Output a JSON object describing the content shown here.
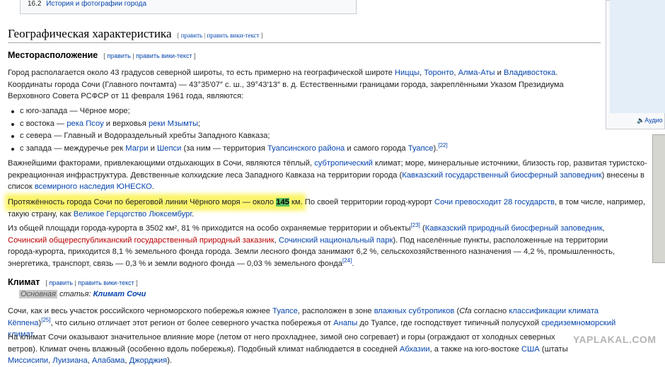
{
  "toc": {
    "num": "16.2",
    "text": "История и фотографии города"
  },
  "section": {
    "title": "Географическая характеристика",
    "edit": "править",
    "edit_wiki": "править вики-текст"
  },
  "location": {
    "title": "Месторасположение",
    "edit": "править",
    "edit_wiki": "править вики-текст"
  },
  "climate": {
    "title": "Климат",
    "edit": "править",
    "edit_wiki": "править вики-текст",
    "note_main": "Основная",
    "note_rest": " статья: ",
    "note_link": "Климат Сочи"
  },
  "p1": {
    "a": "Город располагается около 43 градусов северной широты, то есть примерно на географической широте ",
    "l1": "Ниццы",
    "c1": ", ",
    "l2": "Торонто",
    "c2": ", ",
    "l3": "Алма-Аты",
    "c3": " и ",
    "l4": "Владивостока",
    "b": ". Координаты города Сочи (Главного почтамта) — 43°35′07″ с. ш., 39°43′13″ в. д. Естественными границами города, закреплёнными Указом Президиума Верховного Совета РСФСР от 11 февраля 1961 года, являются:"
  },
  "bullets": {
    "b1": "с юго-запада — Чёрное море;",
    "b2a": "с востока — ",
    "b2l1": "река Псоу",
    "b2b": " и верховья ",
    "b2l2": "реки Мзымты",
    "b2c": ";",
    "b3": "с севера — Главный и Водораздельный хребты Западного Кавказа;",
    "b4a": "с запада — междуречье рек ",
    "b4l1": "Магри",
    "b4b": " и ",
    "b4l2": "Шепси",
    "b4c": " (за ним — территория ",
    "b4l3": "Туапсинского района",
    "b4d": " и самого города ",
    "b4l4": "Туапсе",
    "b4e": ").",
    "b4s": "[22]"
  },
  "p2": {
    "a": "Важнейшими факторами, привлекающими отдыхающих в Сочи, являются тёплый, ",
    "l1": "субтропический",
    "b": " климат; море, минеральные источники, близость гор, развитая туристско-рекреационная инфраструктура. Девственные колхидские леса Западного Кавказа на территории города (",
    "l2": "Кавказский государственный биосферный заповедник",
    "c": ") внесены в список ",
    "l3": "всемирного наследия ЮНЕСКО",
    "d": "."
  },
  "p3": {
    "hl": "Протяжённость города Сочи по береговой линии Чёрного моря — около ",
    "num": "145",
    "hl2": " км.",
    "a": " По своей территории город-курорт ",
    "l1": "Сочи превосходит 28 государств",
    "b": ", в том числе, например, такую страну, как ",
    "l2": "Великое Герцогство Люксембург",
    "c": "."
  },
  "p4": {
    "a": "Из общей площади города-курорта в 3502 км², 81 % приходится на особо охраняемые территории и объекты",
    "s1": "[23]",
    "b": " (",
    "l1": "Кавказский природный биосферный заповедник",
    "c": ", ",
    "l2": "Сочинский общереспубликанский государственный природный заказник",
    "d": ", ",
    "l3": "Сочинский национальный парк",
    "e": "). Под населённые пункты, расположенные на территории города-курорта, приходится 8,1 % земельного фонда города. Земли лесного фонда занимают 6,2 %, сельскохозяйственного назначения — 4,2 %, промышленность, энергетика, транспорт, связь — 0,3 % и земли водного фонда — 0,03 % земельного фонда",
    "s2": "[24]",
    "f": "."
  },
  "p5": {
    "a": "Сочи, как и весь участок российского черноморского побережья южнее ",
    "l1": "Туапсе",
    "b": ", расположен в зоне ",
    "l2": "влажных субтропиков",
    "c": " (",
    "i1": "Cfa",
    "d": " согласно ",
    "l3": "классификации климата Кёппена",
    "e": ")",
    "s1": "[25]",
    "f": ", что сильно отличает этот регион от более северного участка побережья от ",
    "l4": "Анапы",
    "g": " до Туапсе, где господствует типичный полусухой ",
    "l5": "средиземноморский климат",
    "h": "."
  },
  "p6": {
    "a": "На климат Сочи оказывают значительное влияние море (летом от него прохладнее, зимой оно согревает) и горы (ограждают от холодных северных ветров). Климат очень влажный (особенно вдоль побережья). Подобный климат наблюдается в соседней ",
    "l1": "Абхазии",
    "b": ", а также на юго-востоке ",
    "l2": "США",
    "c": " (штаты ",
    "l3": "Миссисипи",
    "c2": ", ",
    "l4": "Луизиана",
    "c3": ", ",
    "l5": "Алабама",
    "c4": ", ",
    "l6": "Джорджия",
    "d": ")."
  },
  "sidebar": {
    "audio": "Аудио"
  },
  "watermark": "YAPLAKAL.COM"
}
